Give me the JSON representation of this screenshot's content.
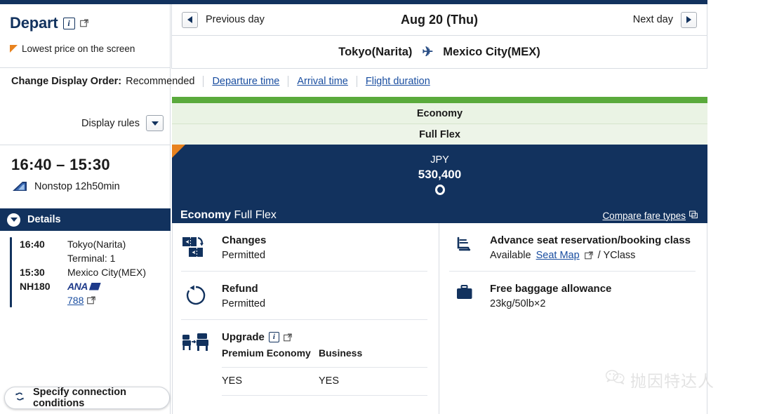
{
  "left_panel": {
    "title": "Depart",
    "info_icon": "info-icon",
    "external_icon": "external-link-icon",
    "lowest_price_note": "Lowest price on the screen",
    "display_rules_label": "Display rules",
    "flight_times": "16:40 – 15:30",
    "stops_duration": "Nonstop 12h50min",
    "details_label": "Details",
    "segments": [
      {
        "time": "16:40",
        "place": "Tokyo(Narita)"
      },
      {
        "time": "",
        "place": "Terminal: 1"
      },
      {
        "time": "15:30",
        "place": "Mexico City(MEX)"
      }
    ],
    "flight_number": "NH180",
    "carrier": "ANA",
    "aircraft": "788",
    "connection_button": "Specify connection conditions"
  },
  "daynav": {
    "previous_day": "Previous day",
    "date": "Aug 20 (Thu)",
    "next_day": "Next day"
  },
  "route": {
    "origin": "Tokyo(Narita)",
    "destination": "Mexico City(MEX)"
  },
  "display_order": {
    "label": "Change Display Order:",
    "current": "Recommended",
    "links": [
      "Departure time",
      "Arrival time",
      "Flight duration"
    ]
  },
  "fare": {
    "cabin": "Economy",
    "fare_type": "Full Flex",
    "currency": "JPY",
    "amount": "530,400",
    "availability_mark": "circle-available-icon",
    "footer_cabin": "Economy",
    "footer_fare": "Full Flex",
    "compare_link": "Compare fare types",
    "accent_green": "#5aaa3c",
    "accent_navy": "#12325e",
    "accent_orange": "#e8821e"
  },
  "details": {
    "changes": {
      "icon": "ticket-change-icon",
      "title": "Changes",
      "value": "Permitted"
    },
    "refund": {
      "icon": "refund-arrow-icon",
      "title": "Refund",
      "value": "Permitted"
    },
    "upgrade": {
      "icon": "seat-upgrade-icon",
      "title": "Upgrade",
      "columns": [
        "Premium Economy",
        "Business"
      ],
      "values": [
        "YES",
        "YES"
      ]
    },
    "seat": {
      "icon": "seat-icon",
      "title": "Advance seat reservation/booking class",
      "available": "Available",
      "seat_map_link": "Seat Map",
      "booking_class": "/ YClass"
    },
    "baggage": {
      "icon": "suitcase-icon",
      "title": "Free baggage allowance",
      "value": "23kg/50lb×2"
    }
  },
  "watermark": {
    "text": "抛因特达人"
  }
}
